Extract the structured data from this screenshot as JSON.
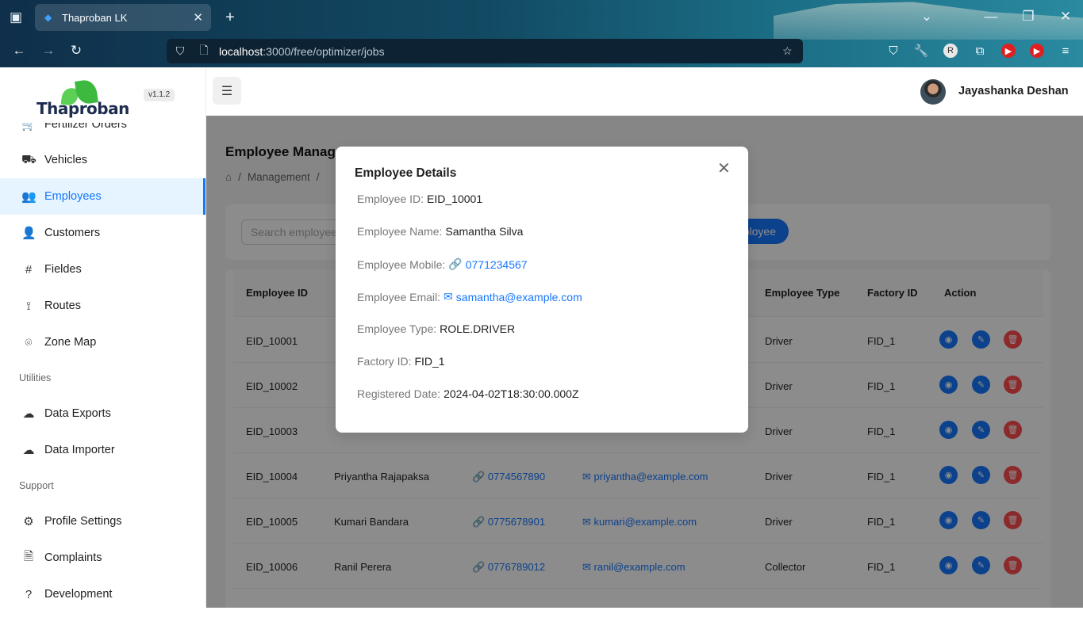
{
  "browser": {
    "tab_title": "Thaproban LK",
    "url_host": "localhost",
    "url_path": ":3000/free/optimizer/jobs"
  },
  "sidebar": {
    "logo_text": "Thaproban",
    "version": "v1.1.2",
    "items": [
      {
        "label": "Fertilizer Orders",
        "icon": "cart-icon"
      },
      {
        "label": "Vehicles",
        "icon": "car-icon"
      },
      {
        "label": "Employees",
        "icon": "users-icon"
      },
      {
        "label": "Customers",
        "icon": "user-icon"
      },
      {
        "label": "Fieldes",
        "icon": "hash-icon"
      },
      {
        "label": "Routes",
        "icon": "route-icon"
      },
      {
        "label": "Zone Map",
        "icon": "map-pin-icon"
      }
    ],
    "section_utilities": "Utilities",
    "utilities": [
      {
        "label": "Data Exports",
        "icon": "cloud-upload-icon"
      },
      {
        "label": "Data Importer",
        "icon": "cloud-download-icon"
      }
    ],
    "section_support": "Support",
    "support": [
      {
        "label": "Profile Settings",
        "icon": "gear-icon"
      },
      {
        "label": "Complaints",
        "icon": "document-icon"
      },
      {
        "label": "Development",
        "icon": "question-icon"
      }
    ]
  },
  "header": {
    "username": "Jayashanka Deshan"
  },
  "page": {
    "title": "Employee Manag",
    "breadcrumb": [
      "Management"
    ],
    "search_placeholder": "Search employee",
    "add_button": "ployee"
  },
  "table": {
    "headers": [
      "Employee ID",
      "",
      "",
      "",
      "Employee Type",
      "Factory ID",
      "Action"
    ],
    "rows": [
      {
        "id": "EID_10001",
        "name": "",
        "mobile": "",
        "email": "",
        "type": "Driver",
        "factory": "FID_1"
      },
      {
        "id": "EID_10002",
        "name": "",
        "mobile": "",
        "email": "",
        "type": "Driver",
        "factory": "FID_1"
      },
      {
        "id": "EID_10003",
        "name": "",
        "mobile": "",
        "email": "",
        "type": "Driver",
        "factory": "FID_1"
      },
      {
        "id": "EID_10004",
        "name": "Priyantha Rajapaksa",
        "mobile": "0774567890",
        "email": "priyantha@example.com",
        "type": "Driver",
        "factory": "FID_1"
      },
      {
        "id": "EID_10005",
        "name": "Kumari Bandara",
        "mobile": "0775678901",
        "email": "kumari@example.com",
        "type": "Driver",
        "factory": "FID_1"
      },
      {
        "id": "EID_10006",
        "name": "Ranil Perera",
        "mobile": "0776789012",
        "email": "ranil@example.com",
        "type": "Collector",
        "factory": "FID_1"
      }
    ]
  },
  "modal": {
    "title": "Employee Details",
    "fields": [
      {
        "label": "Employee ID",
        "value": "EID_10001",
        "kind": "text"
      },
      {
        "label": "Employee Name",
        "value": "Samantha Silva",
        "kind": "text"
      },
      {
        "label": "Employee Mobile",
        "value": "0771234567",
        "kind": "phone"
      },
      {
        "label": "Employee Email",
        "value": "samantha@example.com",
        "kind": "email"
      },
      {
        "label": "Employee Type",
        "value": "ROLE.DRIVER",
        "kind": "text"
      },
      {
        "label": "Factory ID",
        "value": "FID_1",
        "kind": "text"
      },
      {
        "label": "Registered Date",
        "value": "2024-04-02T18:30:00.000Z",
        "kind": "text"
      }
    ]
  },
  "colors": {
    "primary": "#1677ff",
    "danger": "#ff4d4f",
    "active_bg": "#e6f4ff"
  }
}
